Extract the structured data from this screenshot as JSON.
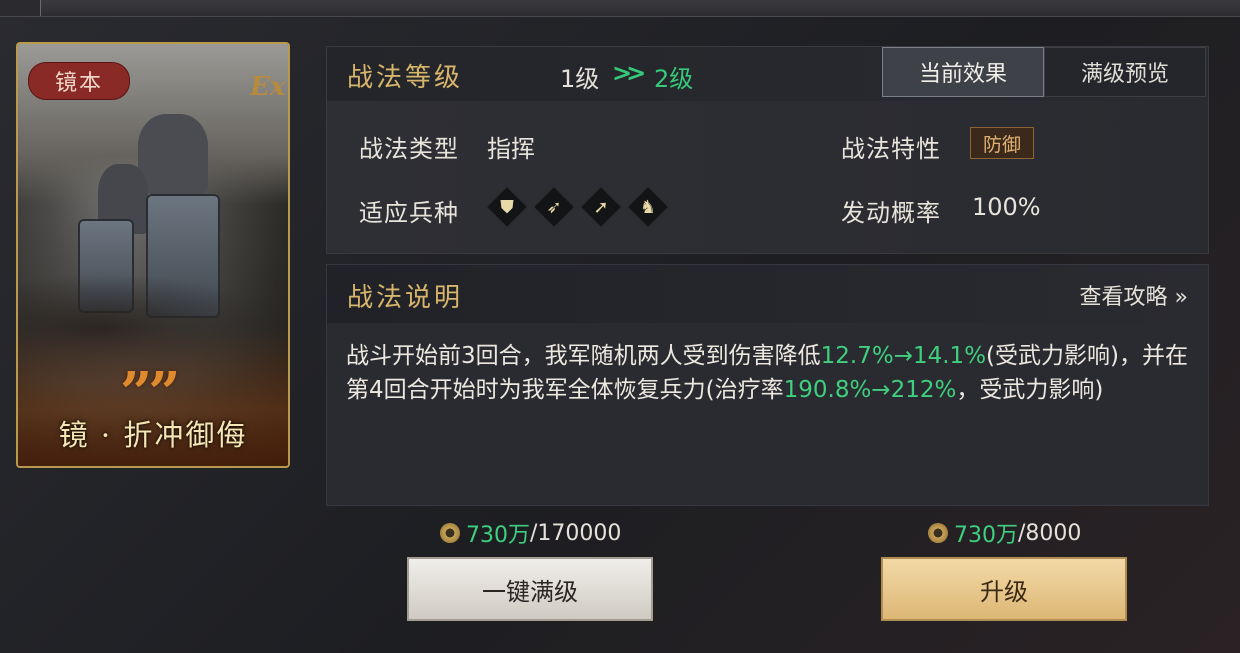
{
  "card": {
    "badge": "镜本",
    "grade": "Ex",
    "name": "镜 · 折冲御侮",
    "quote_mark": "””"
  },
  "level": {
    "title": "战法等级",
    "from": "1级",
    "arrow": ">>",
    "to": "2级"
  },
  "tabs": {
    "current": "当前效果",
    "max_preview": "满级预览"
  },
  "info": {
    "type_label": "战法类型",
    "type_value": "指挥",
    "trait_label": "战法特性",
    "trait_value": "防御",
    "units_label": "适应兵种",
    "units": [
      "shield-icon",
      "bow-icon",
      "spear-icon",
      "horse-icon"
    ],
    "prob_label": "发动概率",
    "prob_value": "100%"
  },
  "description": {
    "title": "战法说明",
    "guide_link": "查看攻略 »",
    "t1": "战斗开始前3回合，我军随机两人受到伤害降低",
    "h1": "12.7%→14.1%",
    "t2": "(受武力影响)，并在第4回合开始时为我军全体恢复兵力(治疗率",
    "h2": "190.8%→212%",
    "t3": "，受武力影响)"
  },
  "costs": {
    "left_have": "730万",
    "left_need": "/170000",
    "right_have": "730万",
    "right_need": "/8000"
  },
  "buttons": {
    "max_level": "一键满级",
    "upgrade": "升级"
  },
  "colors": {
    "gold_title": "#d7b56a",
    "highlight_green": "#3fcf7f",
    "trait_border": "#8d6434"
  }
}
